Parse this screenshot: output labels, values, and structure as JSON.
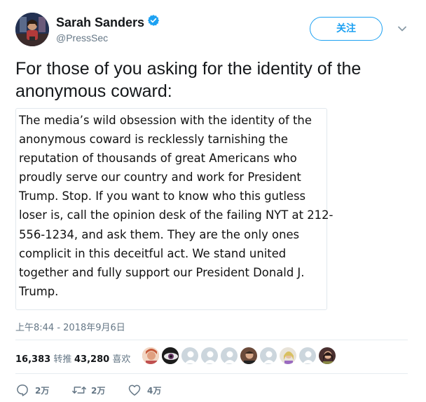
{
  "header": {
    "display_name": "Sarah Sanders",
    "handle": "@PressSec",
    "follow_label": "关注",
    "verified": true,
    "accent_color": "#1da1f2"
  },
  "tweet": {
    "lines": [
      "For those of you asking for the identity of the",
      "anonymous coward:"
    ],
    "quote_lines": [
      "The media’s wild obsession with the identity of the",
      "anonymous coward is recklessly tarnishing the",
      "reputation of thousands of great Americans who",
      "proudly serve our country and work for President",
      "Trump. Stop. If you want to know who this gutless",
      "loser is, call the opinion desk of the failing NYT at 212-",
      "556-1234, and ask them. They are the only ones",
      "complicit in this deceitful act. We stand united",
      "together and fully support our President Donald J.",
      "Trump."
    ],
    "timestamp": "上午8:44 - 2018年9月6日"
  },
  "stats": {
    "retweets_count": "16,383",
    "retweets_label": "转推",
    "likes_count": "43,280",
    "likes_label": "喜欢"
  },
  "actions": {
    "reply_count": "2万",
    "retweet_count": "2万",
    "like_count": "4万"
  }
}
